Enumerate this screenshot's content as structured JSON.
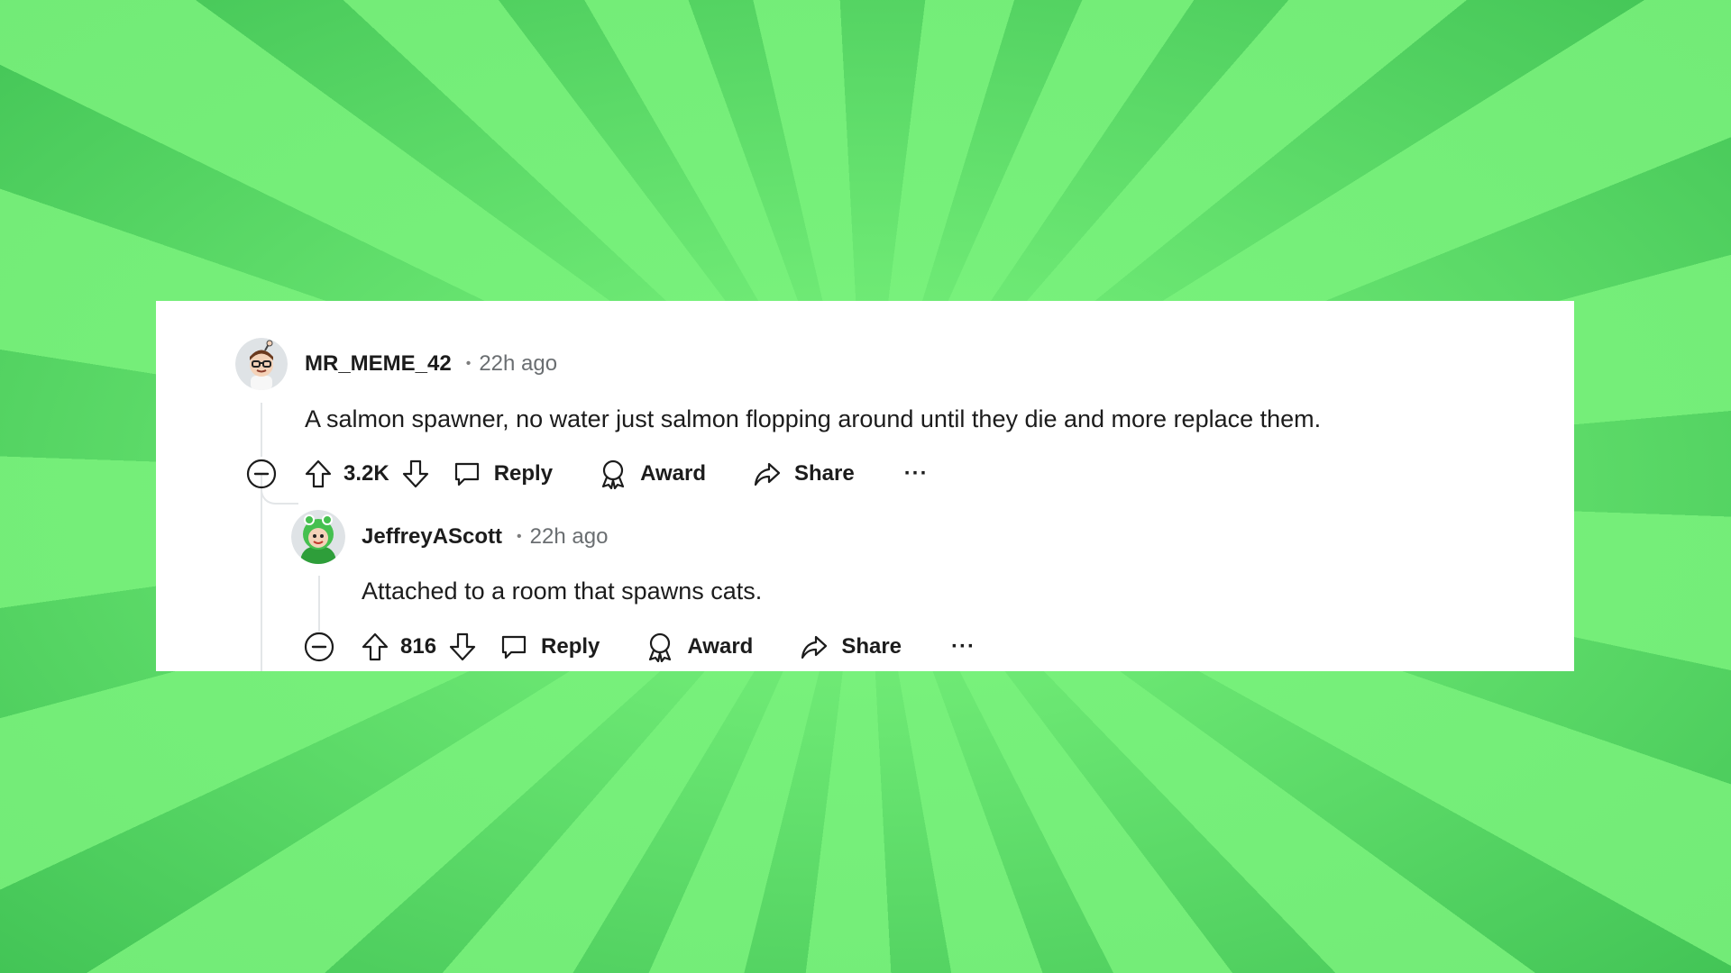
{
  "comments": [
    {
      "username": "MR_MEME_42",
      "separator": "•",
      "time": "22h ago",
      "text": "A salmon spawner, no water just salmon flopping around until they die and more replace them.",
      "score": "3.2K",
      "actions": {
        "reply": "Reply",
        "award": "Award",
        "share": "Share",
        "more": "···"
      },
      "avatar_icon": "snoo-avatar-glasses"
    },
    {
      "username": "JeffreyAScott",
      "separator": "•",
      "time": "22h ago",
      "text": "Attached to a room that spawns cats.",
      "score": "816",
      "actions": {
        "reply": "Reply",
        "award": "Award",
        "share": "Share",
        "more": "···"
      },
      "avatar_icon": "snoo-avatar-green-hood"
    }
  ],
  "colors": {
    "background_light": "#7cf37f",
    "background_dark": "#3fc255",
    "card": "#ffffff",
    "text": "#1c1c1c",
    "meta": "#6a6e71",
    "thread_line": "#e3e6e8"
  }
}
